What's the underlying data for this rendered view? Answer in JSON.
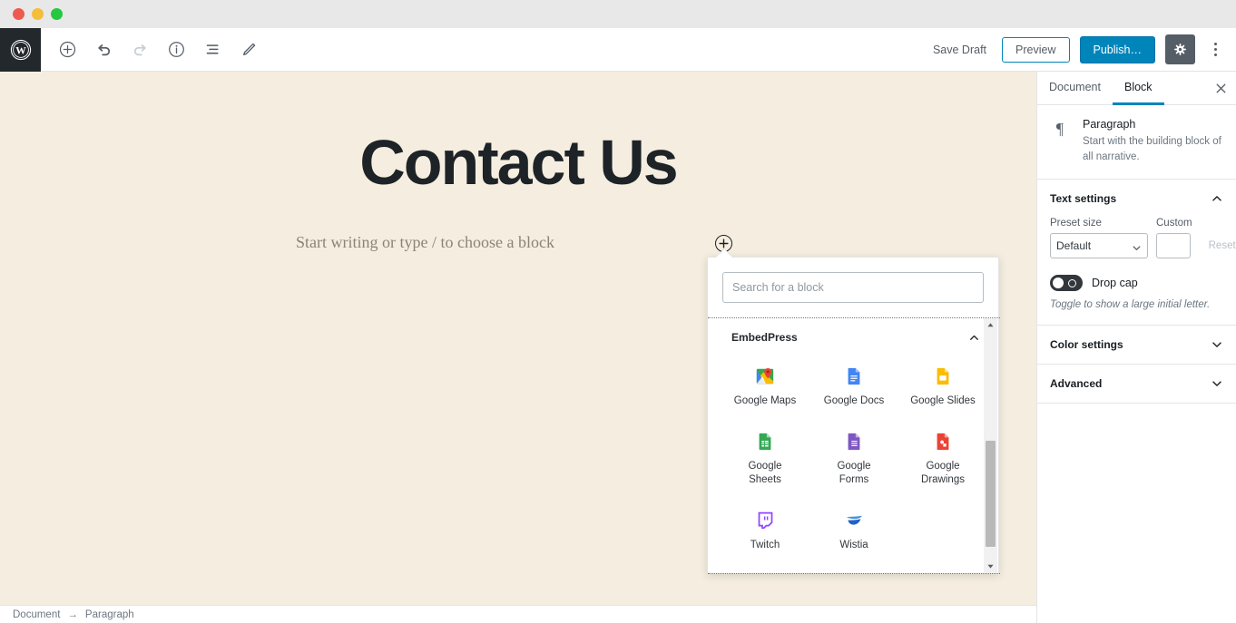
{
  "window": {
    "traffic_lights": [
      "close",
      "minimize",
      "maximize"
    ]
  },
  "toolbar": {
    "logo": "wordpress-logo",
    "left_icons": [
      {
        "name": "add-block-icon",
        "label": "Add block",
        "disabled": false
      },
      {
        "name": "undo-icon",
        "label": "Undo",
        "disabled": false
      },
      {
        "name": "redo-icon",
        "label": "Redo",
        "disabled": true
      },
      {
        "name": "content-info-icon",
        "label": "Content structure",
        "disabled": false
      },
      {
        "name": "block-navigation-icon",
        "label": "Block navigation",
        "disabled": false
      },
      {
        "name": "edit-pencil-icon",
        "label": "Edit",
        "disabled": false
      }
    ],
    "save_draft_label": "Save Draft",
    "preview_label": "Preview",
    "publish_label": "Publish…",
    "settings_gear": "gear-icon",
    "more_menu": "kebab-menu-icon"
  },
  "canvas": {
    "post_title": "Contact Us",
    "paragraph_placeholder": "Start writing or type / to choose a block",
    "inline_inserter": "+"
  },
  "statusbar": {
    "breadcrumb": [
      "Document",
      "Paragraph"
    ],
    "separator": "→"
  },
  "sidebar": {
    "tabs": [
      {
        "label": "Document",
        "active": false
      },
      {
        "label": "Block",
        "active": true
      }
    ],
    "close_label": "✕",
    "block_card": {
      "icon": "paragraph-pilcrow-icon",
      "icon_glyph": "¶",
      "title": "Paragraph",
      "description": "Start with the building block of all narrative."
    },
    "text_settings": {
      "title": "Text settings",
      "expanded": true,
      "preset_size_label": "Preset size",
      "preset_size_value": "Default",
      "preset_size_options": [
        "Default"
      ],
      "custom_label": "Custom",
      "custom_value": "",
      "reset_label": "Reset",
      "drop_cap_label": "Drop cap",
      "drop_cap_on": false,
      "drop_cap_help": "Toggle to show a large initial letter."
    },
    "color_settings": {
      "title": "Color settings",
      "expanded": false
    },
    "advanced": {
      "title": "Advanced",
      "expanded": false
    }
  },
  "inserter": {
    "search_placeholder": "Search for a block",
    "search_value": "",
    "category": {
      "title": "EmbedPress",
      "expanded": true
    },
    "blocks": [
      {
        "label": "Google Maps",
        "icon": "google-maps-icon"
      },
      {
        "label": "Google Docs",
        "icon": "google-docs-icon"
      },
      {
        "label": "Google Slides",
        "icon": "google-slides-icon"
      },
      {
        "label": "Google Sheets",
        "icon": "google-sheets-icon"
      },
      {
        "label": "Google Forms",
        "icon": "google-forms-icon"
      },
      {
        "label": "Google Drawings",
        "icon": "google-drawings-icon"
      },
      {
        "label": "Twitch",
        "icon": "twitch-icon"
      },
      {
        "label": "Wistia",
        "icon": "wistia-icon"
      }
    ],
    "scrollbar": {
      "up": "▲",
      "down": "▼"
    }
  },
  "colors": {
    "canvas_bg": "#f5eee0",
    "accent_blue": "#0085ba",
    "dark": "#23282d",
    "text": "#32373c",
    "muted": "#6c7781",
    "border": "#e2e4e7"
  }
}
